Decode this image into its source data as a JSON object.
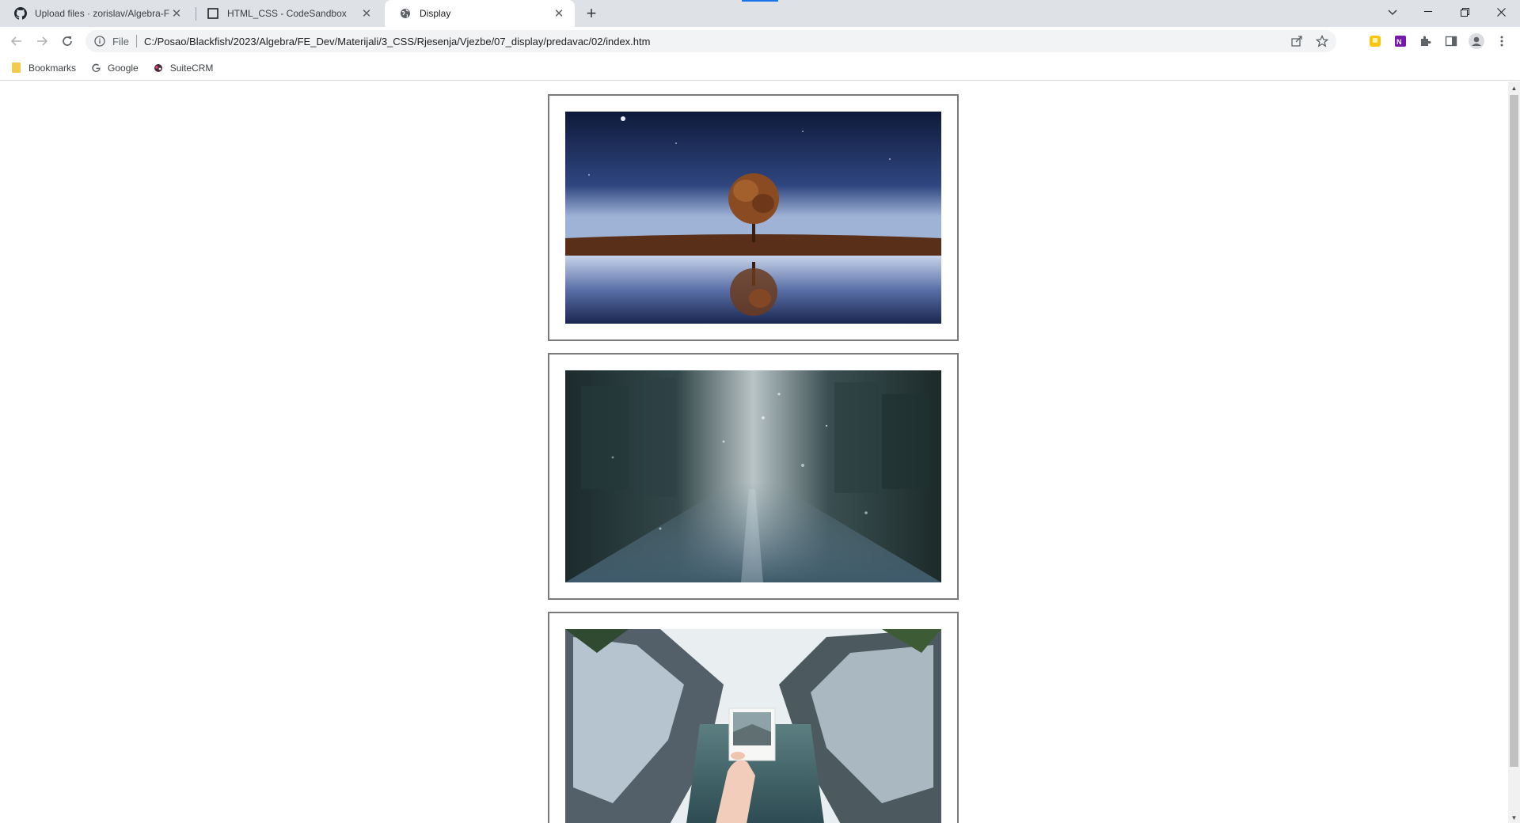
{
  "tabs": [
    {
      "title": "Upload files · zorislav/Algebra-FE",
      "icon": "github-icon"
    },
    {
      "title": "HTML_CSS - CodeSandbox",
      "icon": "codesandbox-icon"
    },
    {
      "title": "Display",
      "icon": "globe-icon",
      "active": true
    }
  ],
  "toolbar": {
    "scheme_label": "File",
    "url": "C:/Posao/Blackfish/2023/Algebra/FE_Dev/Materijali/3_CSS/Rjesenja/Vjezbe/07_display/predavac/02/index.htm"
  },
  "bookmarks": [
    {
      "label": "Bookmarks",
      "icon": "folder-icon"
    },
    {
      "label": "Google",
      "icon": "google-icon"
    },
    {
      "label": "SuiteCRM",
      "icon": "suitecrm-icon"
    }
  ],
  "page": {
    "images": [
      {
        "subject": "lone-tree-reflection"
      },
      {
        "subject": "rainy-window-street"
      },
      {
        "subject": "polaroid-canyon-lake"
      }
    ]
  },
  "colors": {
    "tabstrip": "#dee1e6",
    "accent": "#1a73e8",
    "frame_border": "#7a7a7a"
  }
}
